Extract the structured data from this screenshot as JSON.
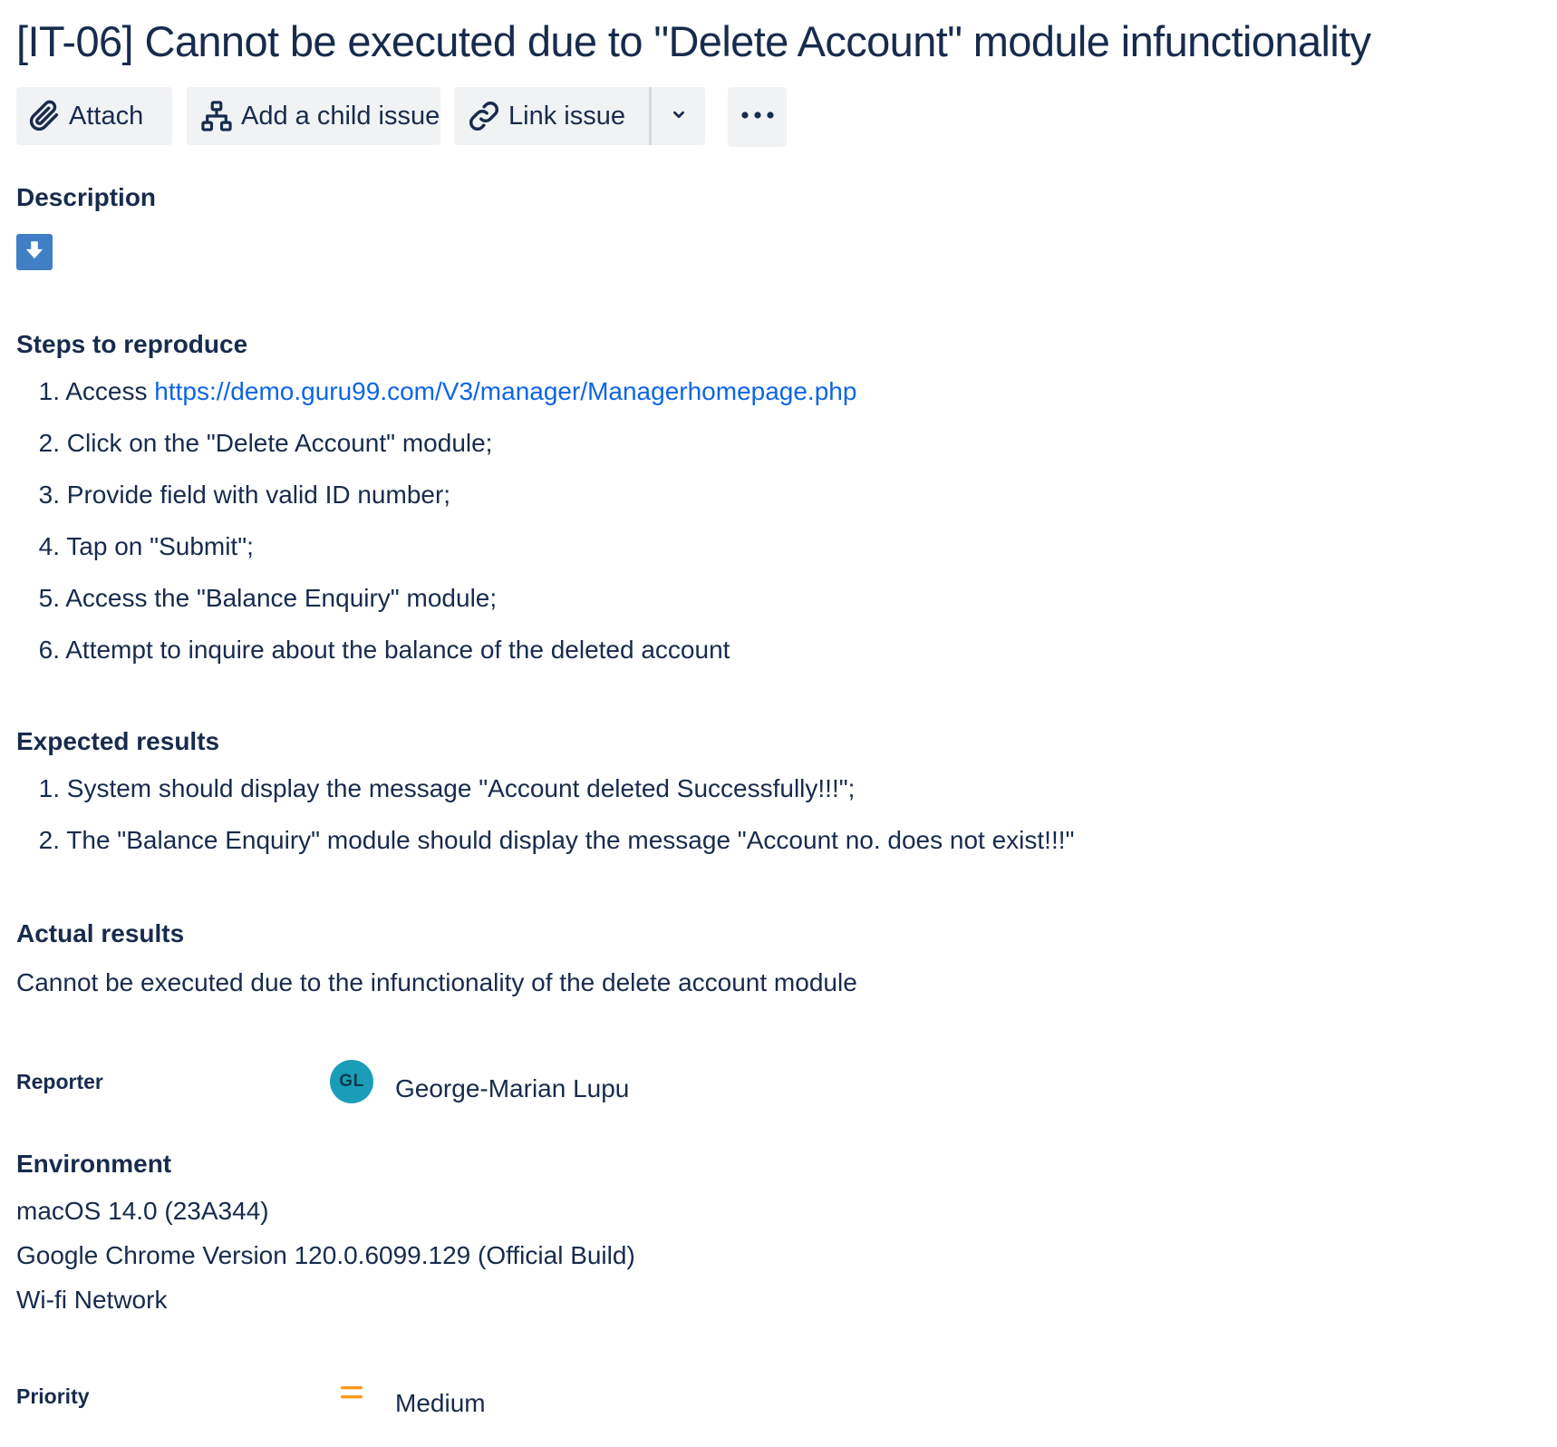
{
  "issue": {
    "title": "[IT-06] Cannot be executed due to \"Delete Account\" module infunctionality"
  },
  "toolbar": {
    "attach_label": "Attach",
    "attach_icon": "paperclip-icon",
    "child_label": "Add a child issue",
    "child_icon": "hierarchy-icon",
    "link_label": "Link issue",
    "link_icon": "link-icon",
    "dropdown_icon": "chevron-down-icon",
    "more_icon": "more-horizontal-icon"
  },
  "description": {
    "heading": "Description",
    "badge_icon": "arrow-down-icon",
    "badge_color": "#3f7fc4",
    "steps": {
      "heading": "Steps to reproduce",
      "items": [
        {
          "num": "1.",
          "text": "Access ",
          "link": "https://demo.guru99.com/V3/manager/Managerhomepage.php"
        },
        {
          "num": "2.",
          "text": "Click on the \"Delete Account\" module;"
        },
        {
          "num": "3.",
          "text": "Provide field with valid ID number;"
        },
        {
          "num": "4.",
          "text": "Tap on \"Submit\";"
        },
        {
          "num": "5.",
          "text": "Access the \"Balance Enquiry\" module;"
        },
        {
          "num": "6.",
          "text": "Attempt to inquire about the balance of the deleted account"
        }
      ]
    },
    "expected": {
      "heading": "Expected results",
      "items": [
        {
          "num": "1.",
          "text": "System should display the message \"Account deleted Successfully!!!\";"
        },
        {
          "num": "2.",
          "text": "The \"Balance Enquiry\" module should display the message \"Account no. does not exist!!!\""
        }
      ]
    },
    "actual": {
      "heading": "Actual results",
      "text": "Cannot be executed due to the infunctionality of the delete account module"
    }
  },
  "reporter": {
    "label": "Reporter",
    "initials": "GL",
    "name": "George-Marian Lupu",
    "avatar_color": "#1a9db8"
  },
  "environment": {
    "heading": "Environment",
    "lines": [
      "macOS 14.0 (23A344)",
      "Google Chrome Version 120.0.6099.129 (Official Build)",
      "Wi-fi Network"
    ]
  },
  "priority": {
    "label": "Priority",
    "value": "Medium",
    "icon": "priority-medium-icon",
    "icon_color": "#ff991f"
  }
}
